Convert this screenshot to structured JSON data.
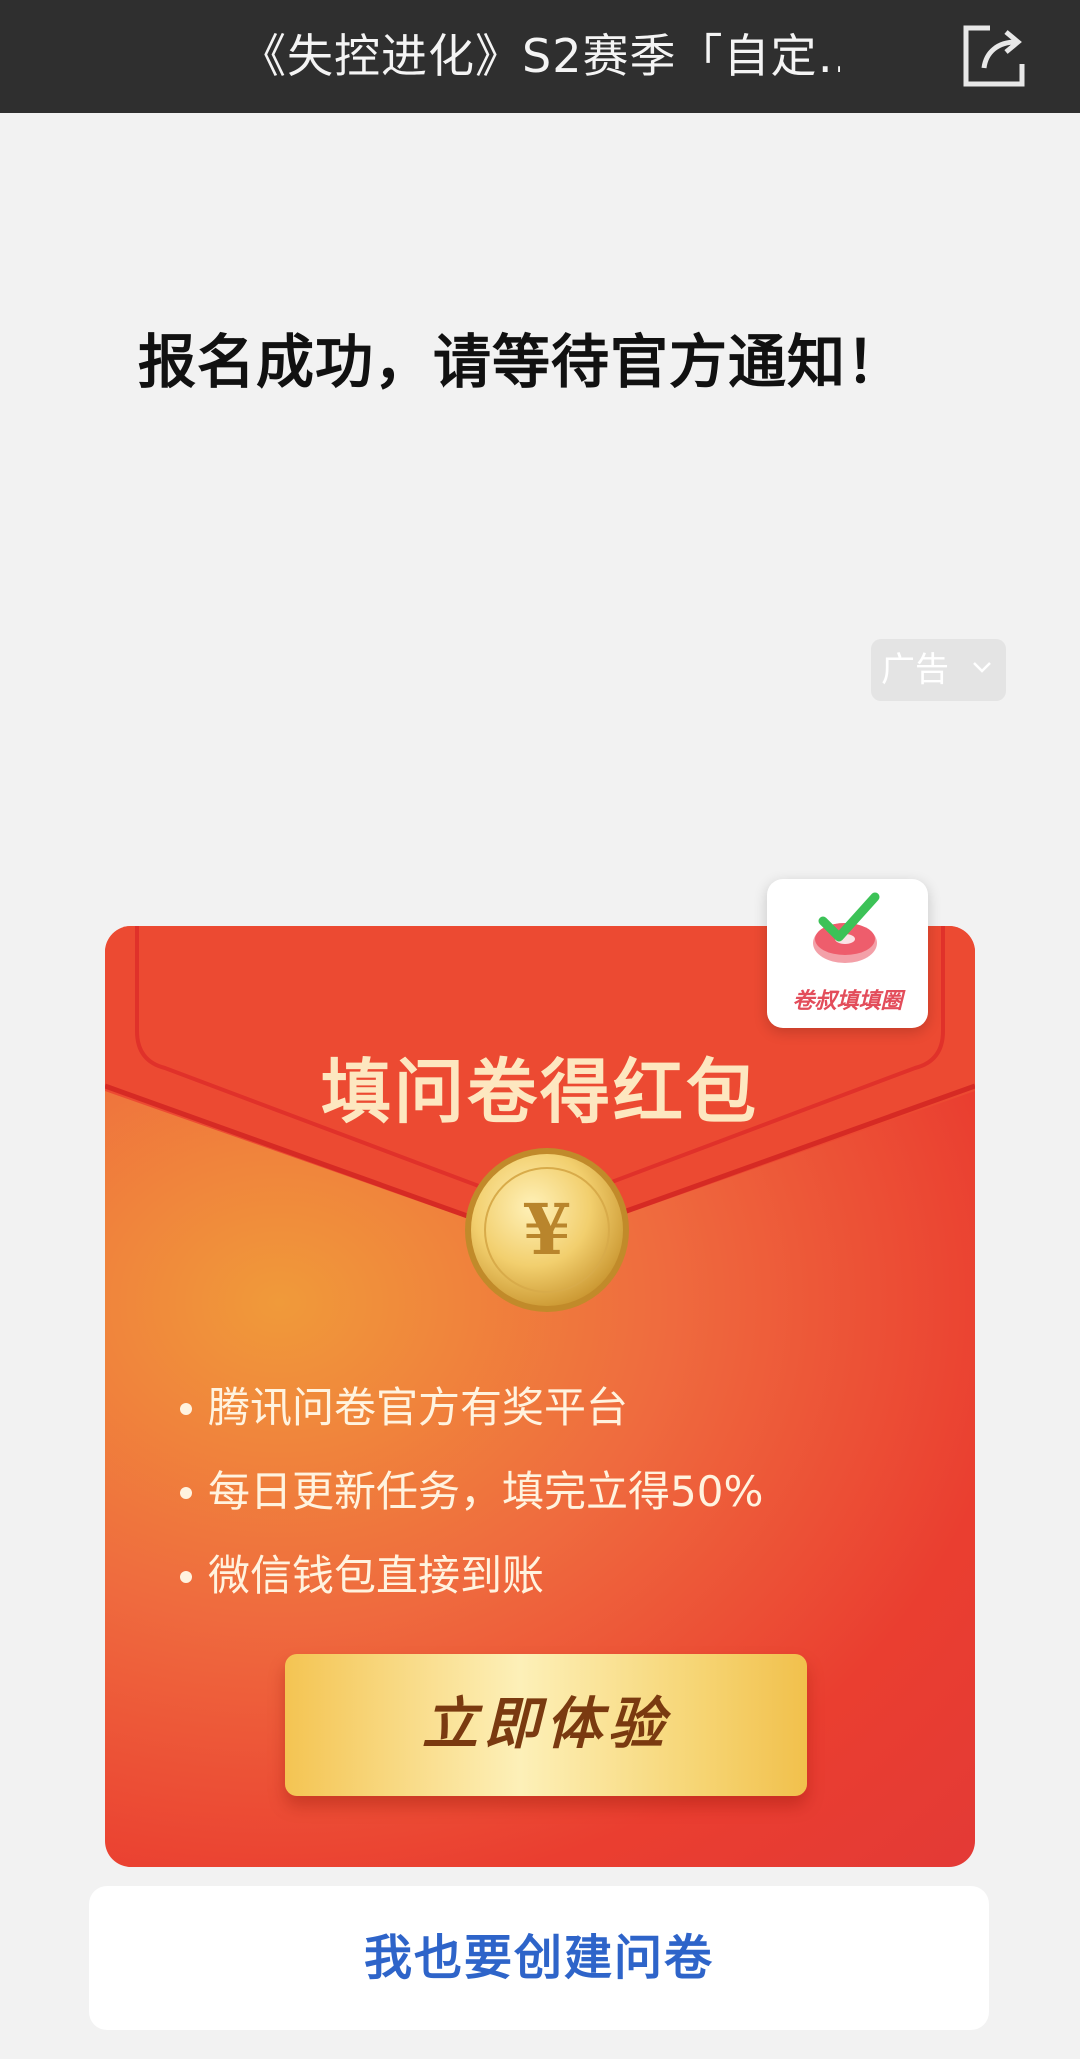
{
  "header": {
    "title": "《失控进化》S2赛季「自定…",
    "share_icon": "share-icon"
  },
  "main": {
    "success_message": "报名成功，请等待官方通知！",
    "ad_label": "广告"
  },
  "ad_card": {
    "badge_label": "卷叔填填圈",
    "headline": "填问卷得红包",
    "coin_symbol": "¥",
    "bullets": [
      "腾讯问卷官方有奖平台",
      "每日更新任务，填完立得50%",
      "微信钱包直接到账"
    ],
    "cta_label": "立即体验"
  },
  "footer": {
    "create_label": "我也要创建问卷"
  },
  "colors": {
    "topbar": "#2f2f2f",
    "background": "#f2f2f2",
    "card_red": "#ea3e30",
    "cta_gold": "#f4c452",
    "link_blue": "#2e64c9"
  }
}
